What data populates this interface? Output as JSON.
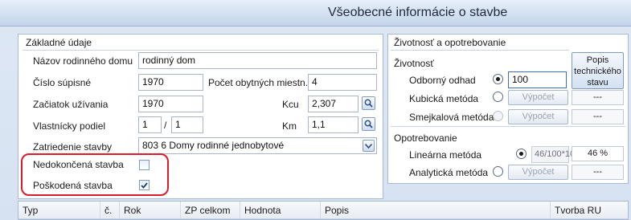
{
  "window": {
    "title": "Všeobecné informácie o stavbe"
  },
  "basic": {
    "group_title": "Základné údaje",
    "name_label": "Názov rodinného domu",
    "name_value": "rodinný dom",
    "sup_label": "Číslo súpisné",
    "sup_value": "1970",
    "residents_label": "Počet obytných miestn.",
    "residents_value": "4",
    "start_label": "Začiatok užívania",
    "start_value": "1970",
    "kcu_label": "Kcu",
    "kcu_value": "2,307",
    "owner_label": "Vlastnícky podiel",
    "owner_num": "1",
    "owner_slash": "/",
    "owner_den": "1",
    "km_label": "Km",
    "km_value": "1,1",
    "class_label": "Zatriedenie stavby",
    "class_value": "803 6 Domy rodinné jednobytové",
    "unfinished_label": "Nedokončená stavba",
    "unfinished_checked": false,
    "damaged_label": "Poškodená stavba",
    "damaged_checked": true
  },
  "life": {
    "group_title": "Životnosť a opotrebovanie",
    "sub_title": "Životnosť",
    "desc_button_line1": "Popis",
    "desc_button_line2": "technického",
    "desc_button_line3": "stavu",
    "expert_label": "Odborný odhad",
    "expert_value": "100",
    "cubic_label": "Kubická metóda",
    "cubic_button": "Výpočet",
    "cubic_value": "---",
    "smejkal_label": "Smejkalová metóda",
    "smejkal_button": "Výpočet",
    "smejkal_value": "---"
  },
  "wear": {
    "sub_title": "Opotrebovanie",
    "linear_label": "Lineárna metóda",
    "linear_formula": "46/100*100",
    "linear_value": "46 %",
    "analytic_label": "Analytická metóda",
    "analytic_button": "Výpočet",
    "analytic_value": "---"
  },
  "table": {
    "columns": [
      "Typ",
      "č.",
      "Rok",
      "ZP celkom",
      "Hodnota",
      "Popis",
      "Tvorba RU"
    ]
  },
  "colors": {
    "highlight": "#dc1c2a",
    "accent": "#3c6fb5"
  }
}
